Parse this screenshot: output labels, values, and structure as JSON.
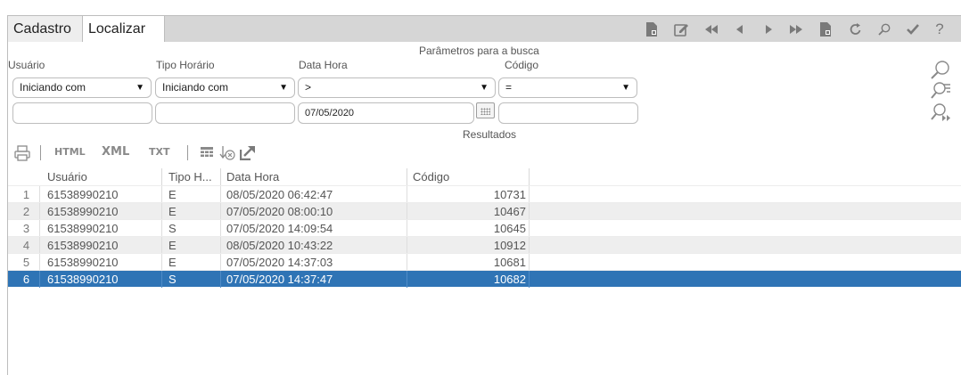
{
  "tabs": [
    {
      "label": "Cadastro"
    },
    {
      "label": "Localizar"
    }
  ],
  "toolbar_icons": [
    "document-icon",
    "edit-icon",
    "first-record-icon",
    "previous-record-icon",
    "next-record-icon",
    "last-record-icon",
    "document-alt-icon",
    "refresh-icon",
    "search-icon",
    "confirm-icon",
    "help-icon"
  ],
  "search": {
    "section_title": "Parâmetros para a busca",
    "fields": [
      {
        "caption": "Usuário",
        "operator": "Iniciando com",
        "value": ""
      },
      {
        "caption": "Tipo Horário",
        "operator": "Iniciando com",
        "value": ""
      },
      {
        "caption": "Data Hora",
        "operator": ">",
        "value": "07/05/2020"
      },
      {
        "caption": "Código",
        "operator": "=",
        "value": ""
      }
    ]
  },
  "results": {
    "section_title": "Resultados",
    "export_options": [
      "HTML",
      "XML",
      "TXT"
    ],
    "columns": [
      "Usuário",
      "Tipo H...",
      "Data Hora",
      "Código"
    ],
    "rows": [
      {
        "n": "1",
        "usuario": "61538990210",
        "tipo": "E",
        "data_hora": "08/05/2020 06:42:47",
        "codigo": "10731"
      },
      {
        "n": "2",
        "usuario": "61538990210",
        "tipo": "E",
        "data_hora": "07/05/2020 08:00:10",
        "codigo": "10467"
      },
      {
        "n": "3",
        "usuario": "61538990210",
        "tipo": "S",
        "data_hora": "07/05/2020 14:09:54",
        "codigo": "10645"
      },
      {
        "n": "4",
        "usuario": "61538990210",
        "tipo": "E",
        "data_hora": "08/05/2020 10:43:22",
        "codigo": "10912"
      },
      {
        "n": "5",
        "usuario": "61538990210",
        "tipo": "E",
        "data_hora": "07/05/2020 14:37:03",
        "codigo": "10681"
      },
      {
        "n": "6",
        "usuario": "61538990210",
        "tipo": "S",
        "data_hora": "07/05/2020 14:37:47",
        "codigo": "10682"
      }
    ],
    "selected_row": "6"
  },
  "colors": {
    "selection": "#2f74b5",
    "topbar": "#d6d6d6",
    "icon": "#7a7a7a"
  }
}
